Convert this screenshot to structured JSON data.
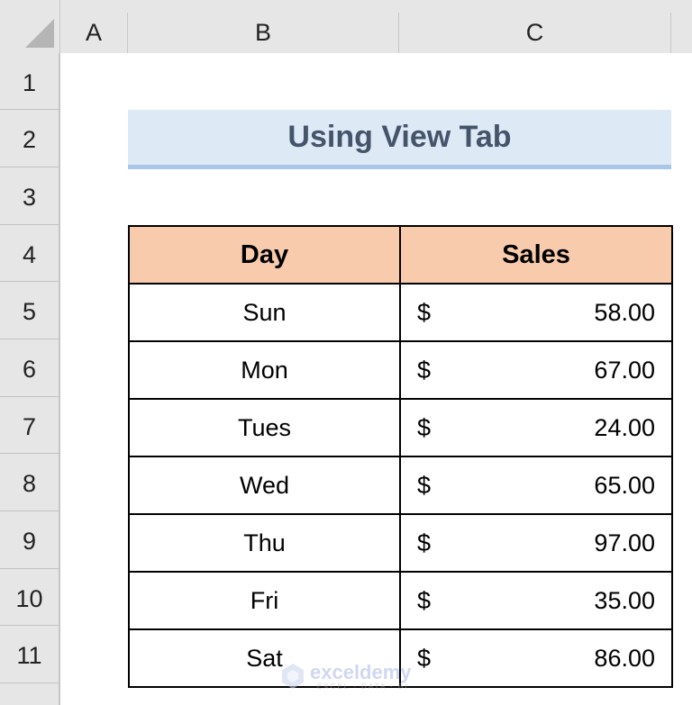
{
  "columns": [
    "A",
    "B",
    "C"
  ],
  "rows": [
    "1",
    "2",
    "3",
    "4",
    "5",
    "6",
    "7",
    "8",
    "9",
    "10",
    "11"
  ],
  "title": "Using View Tab",
  "table": {
    "headers": [
      "Day",
      "Sales"
    ],
    "currency_symbol": "$",
    "rows": [
      {
        "day": "Sun",
        "sales": "58.00"
      },
      {
        "day": "Mon",
        "sales": "67.00"
      },
      {
        "day": "Tues",
        "sales": "24.00"
      },
      {
        "day": "Wed",
        "sales": "65.00"
      },
      {
        "day": "Thu",
        "sales": "97.00"
      },
      {
        "day": "Fri",
        "sales": "35.00"
      },
      {
        "day": "Sat",
        "sales": "86.00"
      }
    ]
  },
  "watermark": {
    "name": "exceldemy",
    "tagline": "EXCEL · DATA · BI"
  },
  "colors": {
    "title_bg": "#dde9f5",
    "title_text": "#44546a",
    "header_bg": "#f8cbad",
    "title_underline": "#a9c6e8"
  }
}
